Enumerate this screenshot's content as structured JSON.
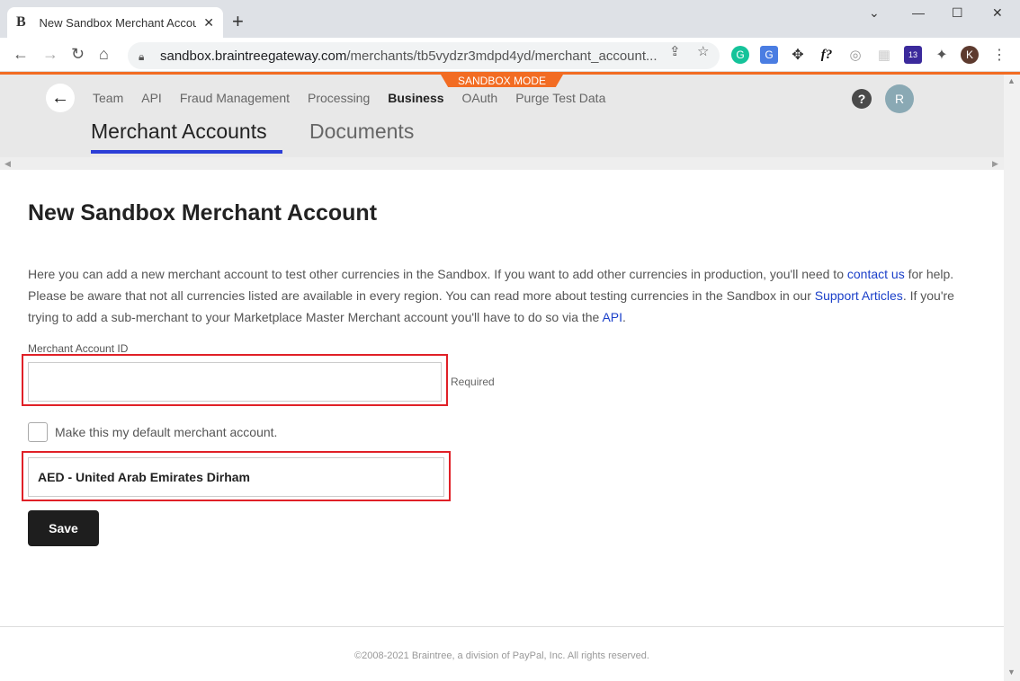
{
  "browser": {
    "tab_title": "New Sandbox Merchant Accou",
    "tab_favicon": "B",
    "url_host": "sandbox.braintreegateway.com",
    "url_path": "/merchants/tb5vydzr3mdpd4yd/merchant_account...",
    "extension_badge": "13",
    "profile_initial": "K"
  },
  "app": {
    "sandbox_badge": "SANDBOX MODE",
    "nav": [
      "Team",
      "API",
      "Fraud Management",
      "Processing",
      "Business",
      "OAuth",
      "Purge Test Data"
    ],
    "nav_active": "Business",
    "help_label": "?",
    "avatar_initial": "R",
    "subtabs": [
      "Merchant Accounts",
      "Documents"
    ]
  },
  "content": {
    "title": "New Sandbox Merchant Account",
    "intro_1": "Here you can add a new merchant account to test other currencies in the Sandbox. If you want to add other currencies in production, you'll need to ",
    "link_contact": "contact us",
    "intro_2": " for help. Please be aware that not all currencies listed are available in every region. You can read more about testing currencies in the Sandbox in our ",
    "link_support": "Support Articles",
    "intro_3": ". If you're trying to add a sub-merchant to your Marketplace Master Merchant account you'll have to do so via the ",
    "link_api": "API",
    "intro_4": ".",
    "field_label": "Merchant Account ID",
    "field_value": "",
    "required_text": "Required",
    "checkbox_label": "Make this my default merchant account.",
    "currency_selected": "AED - United Arab Emirates Dirham",
    "save_label": "Save"
  },
  "footer": "©2008-2021 Braintree, a division of PayPal, Inc. All rights reserved.",
  "colors": {
    "accent_orange": "#f26c23",
    "tab_underline": "#2c3ed6",
    "highlight_red": "#e02027",
    "link_blue": "#1a3fc9"
  }
}
